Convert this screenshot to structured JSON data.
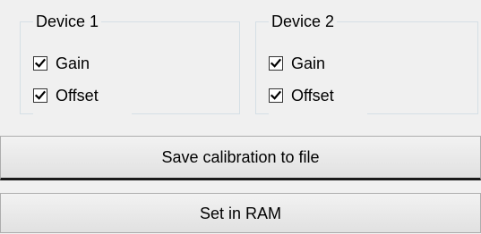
{
  "devices": [
    {
      "title": "Device 1",
      "gain": {
        "label": "Gain",
        "checked": true
      },
      "offset": {
        "label": "Offset",
        "checked": true
      }
    },
    {
      "title": "Device 2",
      "gain": {
        "label": "Gain",
        "checked": true
      },
      "offset": {
        "label": "Offset",
        "checked": true
      }
    }
  ],
  "buttons": {
    "save_label": "Save calibration to file",
    "ram_label": "Set in RAM"
  }
}
